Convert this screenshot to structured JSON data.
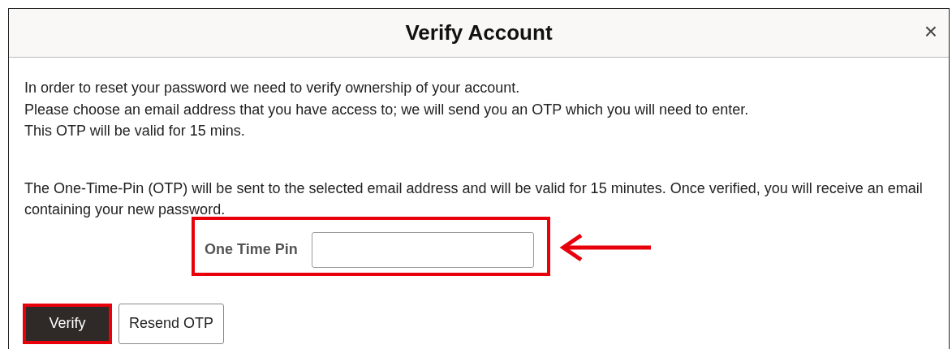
{
  "dialog": {
    "title": "Verify Account",
    "close_icon": "×"
  },
  "intro_lines": [
    "In order to reset your password we need to verify ownership of your account.",
    "Please choose an email address that you have access to; we will send you an OTP which you will need to enter.",
    "This OTP will be valid for 15 mins."
  ],
  "notice": "The One-Time-Pin (OTP) will be sent to the selected email address and will be valid for 15 minutes. Once verified, you will receive an email containing your new password.",
  "otp_field": {
    "label": "One Time Pin",
    "highlighted": true,
    "arrow": true
  },
  "buttons": [
    {
      "label": "Verify",
      "kind": "primary",
      "highlighted": true
    },
    {
      "label": "Resend OTP",
      "kind": "secondary",
      "highlighted": false
    }
  ]
}
